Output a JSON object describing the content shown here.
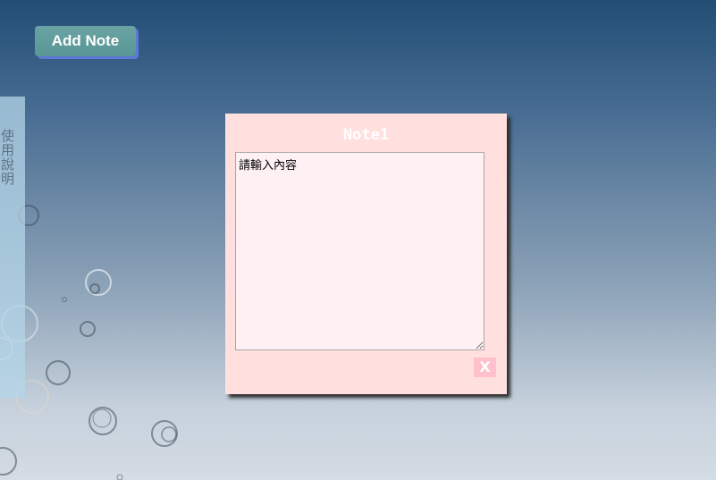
{
  "toolbar": {
    "add_note_label": "Add Note"
  },
  "sidebar": {
    "help_label": "使用說明"
  },
  "notes": [
    {
      "title": "Note1",
      "content": "請輸入內容",
      "close_label": "X"
    }
  ],
  "colors": {
    "note_background": "#ffe0df",
    "textarea_background": "#fff0f4",
    "close_button": "#ffc0cb",
    "add_button": "#5f9c9d",
    "add_button_shadow": "#5b79d6"
  }
}
